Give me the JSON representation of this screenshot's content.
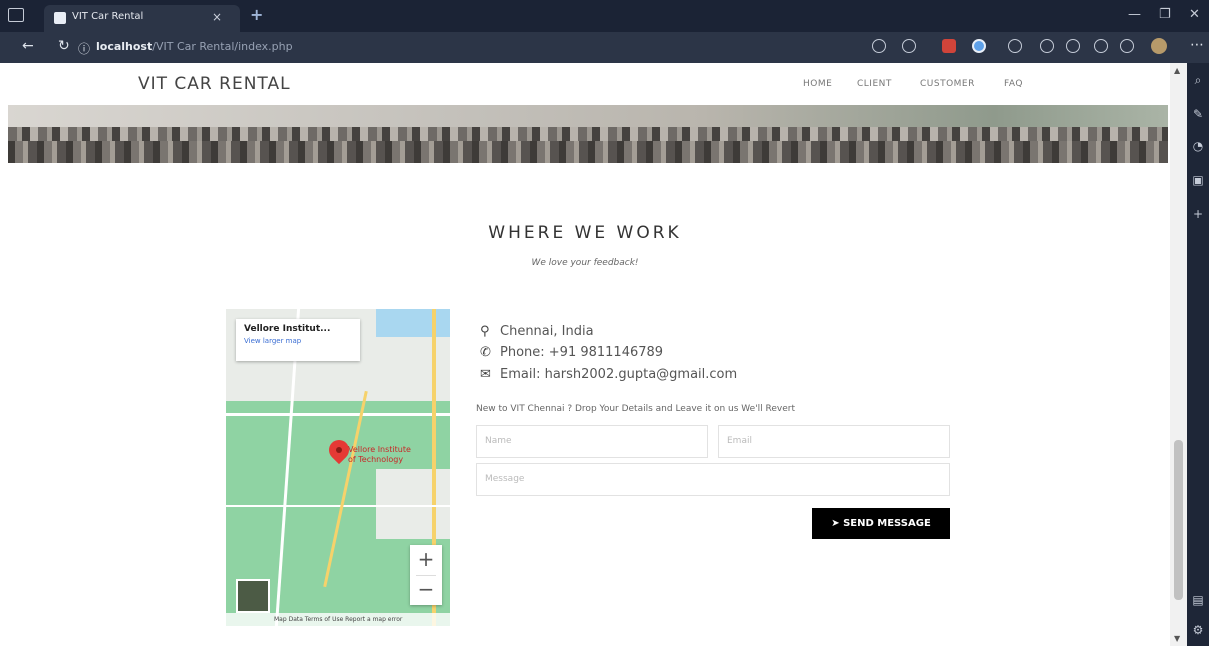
{
  "browser": {
    "tab_title": "VIT Car Rental",
    "tab_close": "×",
    "new_tab": "+",
    "url_host": "localhost",
    "url_path": "/VIT Car Rental/index.php"
  },
  "site": {
    "brand": "VIT CAR RENTAL",
    "nav": [
      "HOME",
      "CLIENT",
      "CUSTOMER",
      "FAQ"
    ]
  },
  "section": {
    "title": "WHERE WE WORK",
    "subtitle": "We love your feedback!"
  },
  "map": {
    "card_title": "Vellore Institut...",
    "card_link": "View larger map",
    "place_line1": "Vellore Institute",
    "place_line2": "of Technology",
    "zoom_in": "+",
    "zoom_out": "−",
    "footer": "Map Data   Terms of Use   Report a map error"
  },
  "contact": {
    "location": "Chennai, India",
    "phone": "Phone: +91 9811146789",
    "email": "Email: harsh2002.gupta@gmail.com",
    "drop_text": "New to VIT Chennai ? Drop Your Details and Leave it on us We'll Revert",
    "name_placeholder": "Name",
    "email_placeholder": "Email",
    "message_placeholder": "Message",
    "send_label": "SEND MESSAGE"
  }
}
